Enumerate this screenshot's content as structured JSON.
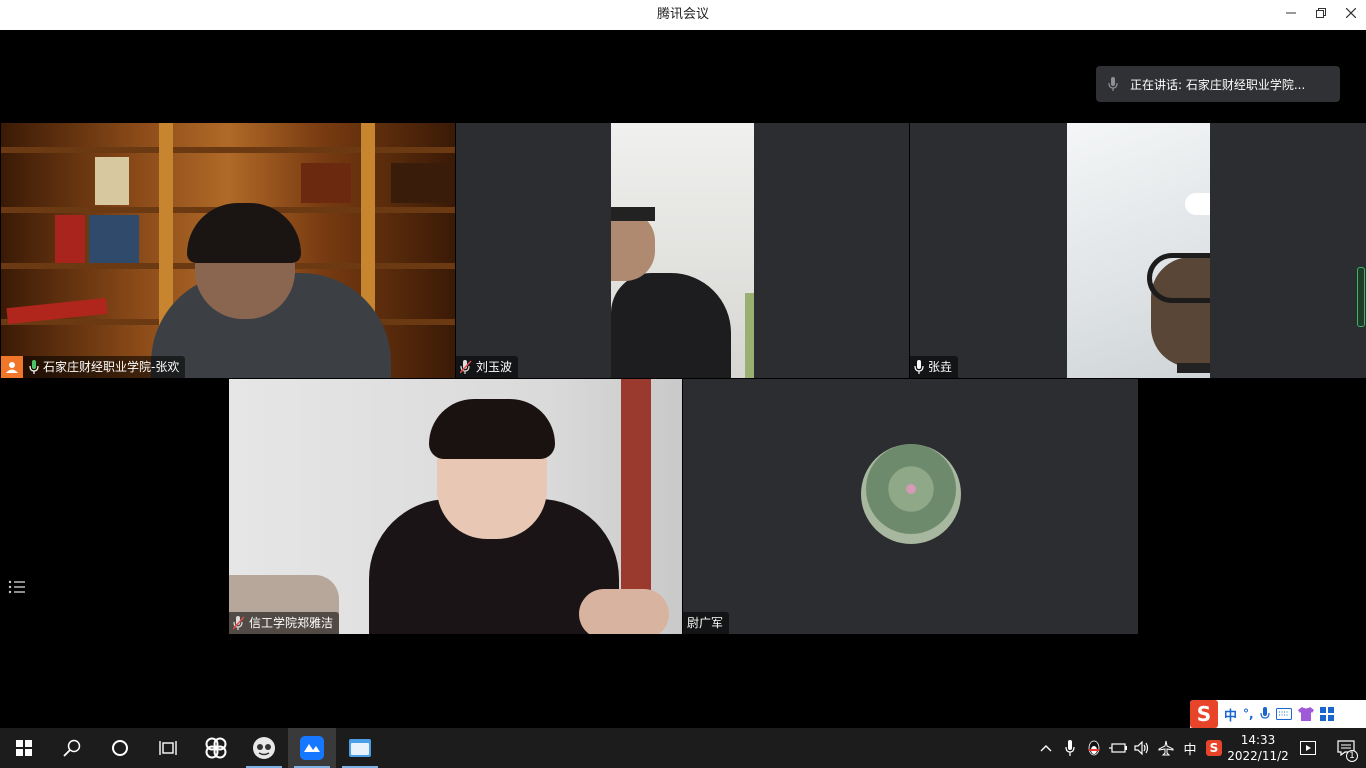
{
  "window": {
    "title": "腾讯会议"
  },
  "speaking": {
    "label": "正在讲话: 石家庄财经职业学院..."
  },
  "participants": [
    {
      "name": "石家庄财经职业学院-张欢",
      "mic": "on",
      "host": true,
      "video": true
    },
    {
      "name": "刘玉波",
      "mic": "muted",
      "video": true
    },
    {
      "name": "张垚",
      "mic": "on",
      "video": true
    },
    {
      "name": "信工学院郑雅洁",
      "mic": "muted",
      "video": true
    },
    {
      "name": "尉广军",
      "mic": "none",
      "video": false
    }
  ],
  "taskbar": {
    "apps": [
      "start",
      "search",
      "cortana",
      "task-view",
      "pinwheel",
      "browser",
      "tencent-meeting",
      "file-explorer"
    ]
  },
  "ime": {
    "lang": "中",
    "punct": "°,"
  },
  "tray": {
    "lang": "中",
    "time": "14:33",
    "date": "2022/11/2",
    "notifications": "1"
  },
  "colors": {
    "host_badge": "#f0772a",
    "active_border": "#3fb36a",
    "tile_bg": "#2b2d30",
    "mic_green": "#4cc364"
  }
}
